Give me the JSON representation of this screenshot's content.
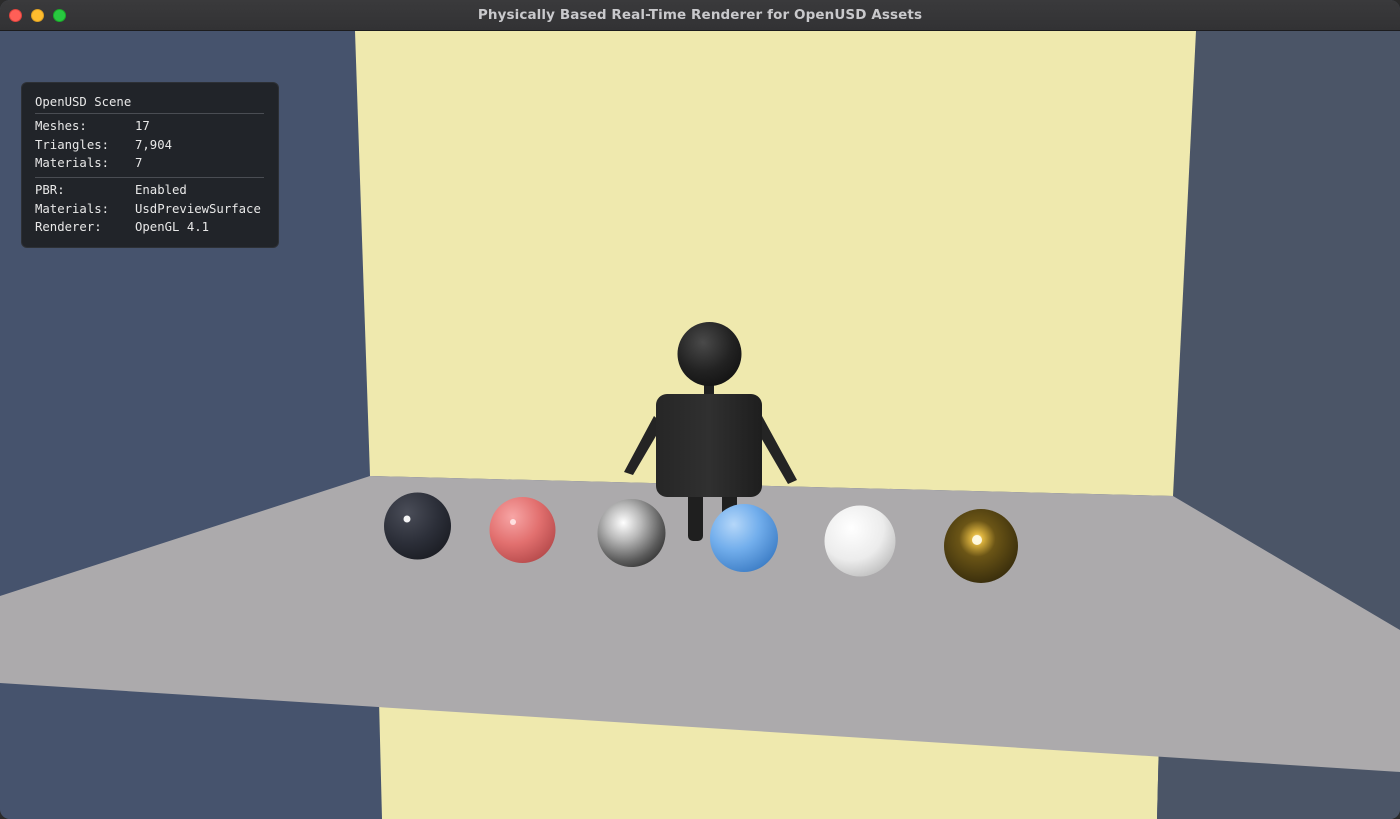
{
  "window": {
    "title": "Physically Based Real-Time Renderer for OpenUSD Assets"
  },
  "scene_info": {
    "title": "OpenUSD Scene",
    "stats": [
      {
        "label": "Meshes:",
        "value": "17"
      },
      {
        "label": "Triangles:",
        "value": "7,904"
      },
      {
        "label": "Materials:",
        "value": "7"
      }
    ],
    "render": [
      {
        "label": "PBR:",
        "value": "Enabled"
      },
      {
        "label": "Materials:",
        "value": "UsdPreviewSurface"
      },
      {
        "label": "Renderer:",
        "value": "OpenGL 4.1"
      }
    ]
  },
  "scene_colors": {
    "side_walls": "#46536d",
    "back_wall": "#efe9ae",
    "floor": "#acaaac",
    "figure": "#222222"
  },
  "spheres": [
    {
      "name": "dark",
      "color": "#2e313b"
    },
    {
      "name": "pink",
      "color": "#e87476"
    },
    {
      "name": "chrome",
      "color": "#9a9a9a"
    },
    {
      "name": "blue",
      "color": "#6fa8e6"
    },
    {
      "name": "white",
      "color": "#e6e6e6"
    },
    {
      "name": "gold",
      "color": "#4a3a10"
    }
  ]
}
